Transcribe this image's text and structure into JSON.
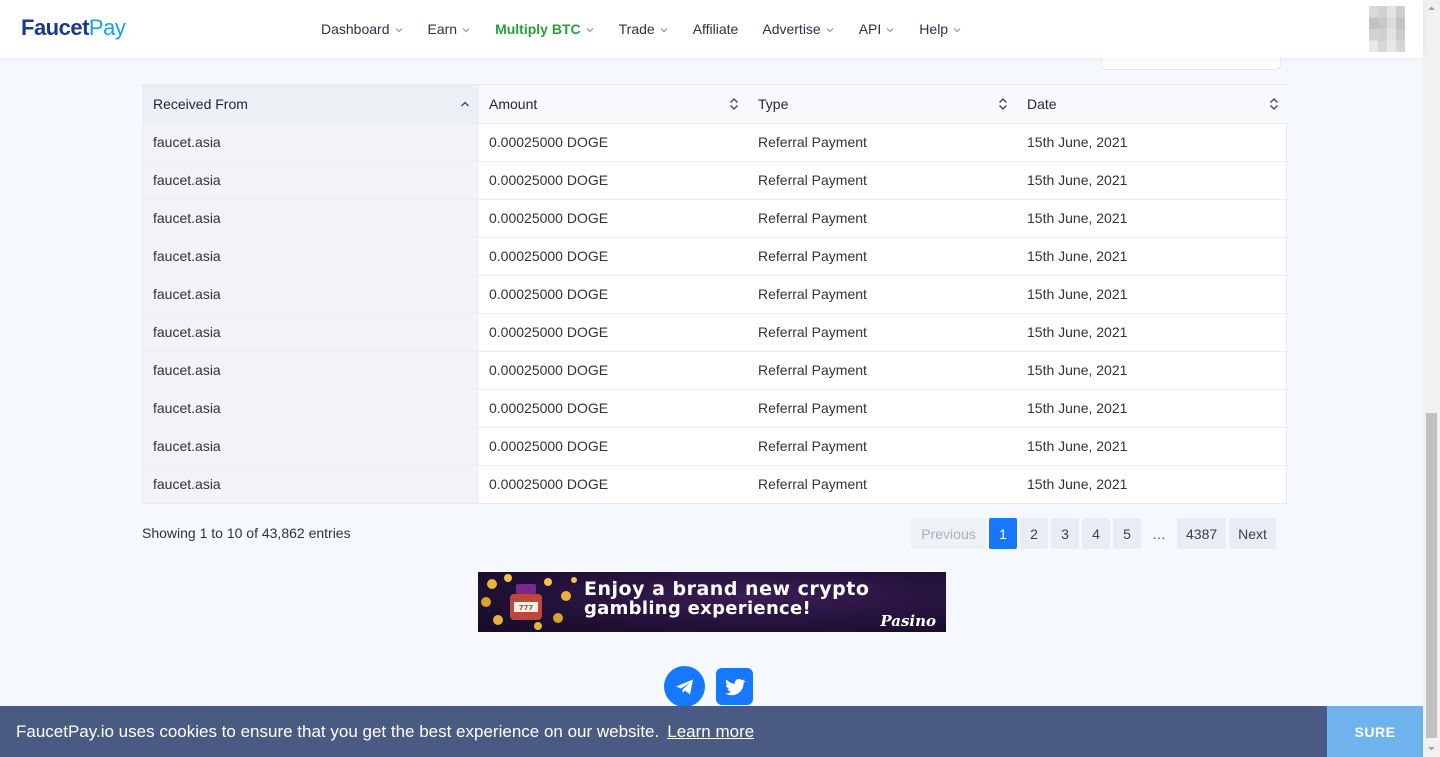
{
  "header": {
    "logo_part1": "Faucet",
    "logo_part2": "Pay",
    "nav": [
      {
        "label": "Dashboard",
        "has_dropdown": true
      },
      {
        "label": "Earn",
        "has_dropdown": true
      },
      {
        "label": "Multiply BTC",
        "has_dropdown": true,
        "active": true
      },
      {
        "label": "Trade",
        "has_dropdown": true
      },
      {
        "label": "Affiliate",
        "has_dropdown": false
      },
      {
        "label": "Advertise",
        "has_dropdown": true
      },
      {
        "label": "API",
        "has_dropdown": true
      },
      {
        "label": "Help",
        "has_dropdown": true
      }
    ],
    "active_color": "#2a9d3e"
  },
  "table": {
    "columns": [
      {
        "label": "Received From",
        "sort": "asc"
      },
      {
        "label": "Amount",
        "sort": "both"
      },
      {
        "label": "Type",
        "sort": "both"
      },
      {
        "label": "Date",
        "sort": "both"
      }
    ],
    "rows": [
      [
        "faucet.asia",
        "0.00025000 DOGE",
        "Referral Payment",
        "15th June, 2021"
      ],
      [
        "faucet.asia",
        "0.00025000 DOGE",
        "Referral Payment",
        "15th June, 2021"
      ],
      [
        "faucet.asia",
        "0.00025000 DOGE",
        "Referral Payment",
        "15th June, 2021"
      ],
      [
        "faucet.asia",
        "0.00025000 DOGE",
        "Referral Payment",
        "15th June, 2021"
      ],
      [
        "faucet.asia",
        "0.00025000 DOGE",
        "Referral Payment",
        "15th June, 2021"
      ],
      [
        "faucet.asia",
        "0.00025000 DOGE",
        "Referral Payment",
        "15th June, 2021"
      ],
      [
        "faucet.asia",
        "0.00025000 DOGE",
        "Referral Payment",
        "15th June, 2021"
      ],
      [
        "faucet.asia",
        "0.00025000 DOGE",
        "Referral Payment",
        "15th June, 2021"
      ],
      [
        "faucet.asia",
        "0.00025000 DOGE",
        "Referral Payment",
        "15th June, 2021"
      ],
      [
        "faucet.asia",
        "0.00025000 DOGE",
        "Referral Payment",
        "15th June, 2021"
      ]
    ]
  },
  "pagination": {
    "showing": "Showing 1 to 10 of 43,862 entries",
    "previous": "Previous",
    "pages": [
      "1",
      "2",
      "3",
      "4",
      "5"
    ],
    "current": "1",
    "ellipsis": "…",
    "last_page": "4387",
    "next": "Next",
    "current_color": "#1677ff"
  },
  "banner": {
    "line1": "Enjoy a brand new crypto",
    "line2": "gambling experience!",
    "brand": "Pasino"
  },
  "social": {
    "icons": [
      "telegram-icon",
      "twitter-icon"
    ],
    "color": "#1677ff"
  },
  "cookie": {
    "message": "FaucetPay.io uses cookies to ensure that you get the best experience on our website.",
    "learn_more": "Learn more",
    "button": "SURE",
    "bar_color": "#4a5b83",
    "button_color": "#6fb3ec"
  }
}
